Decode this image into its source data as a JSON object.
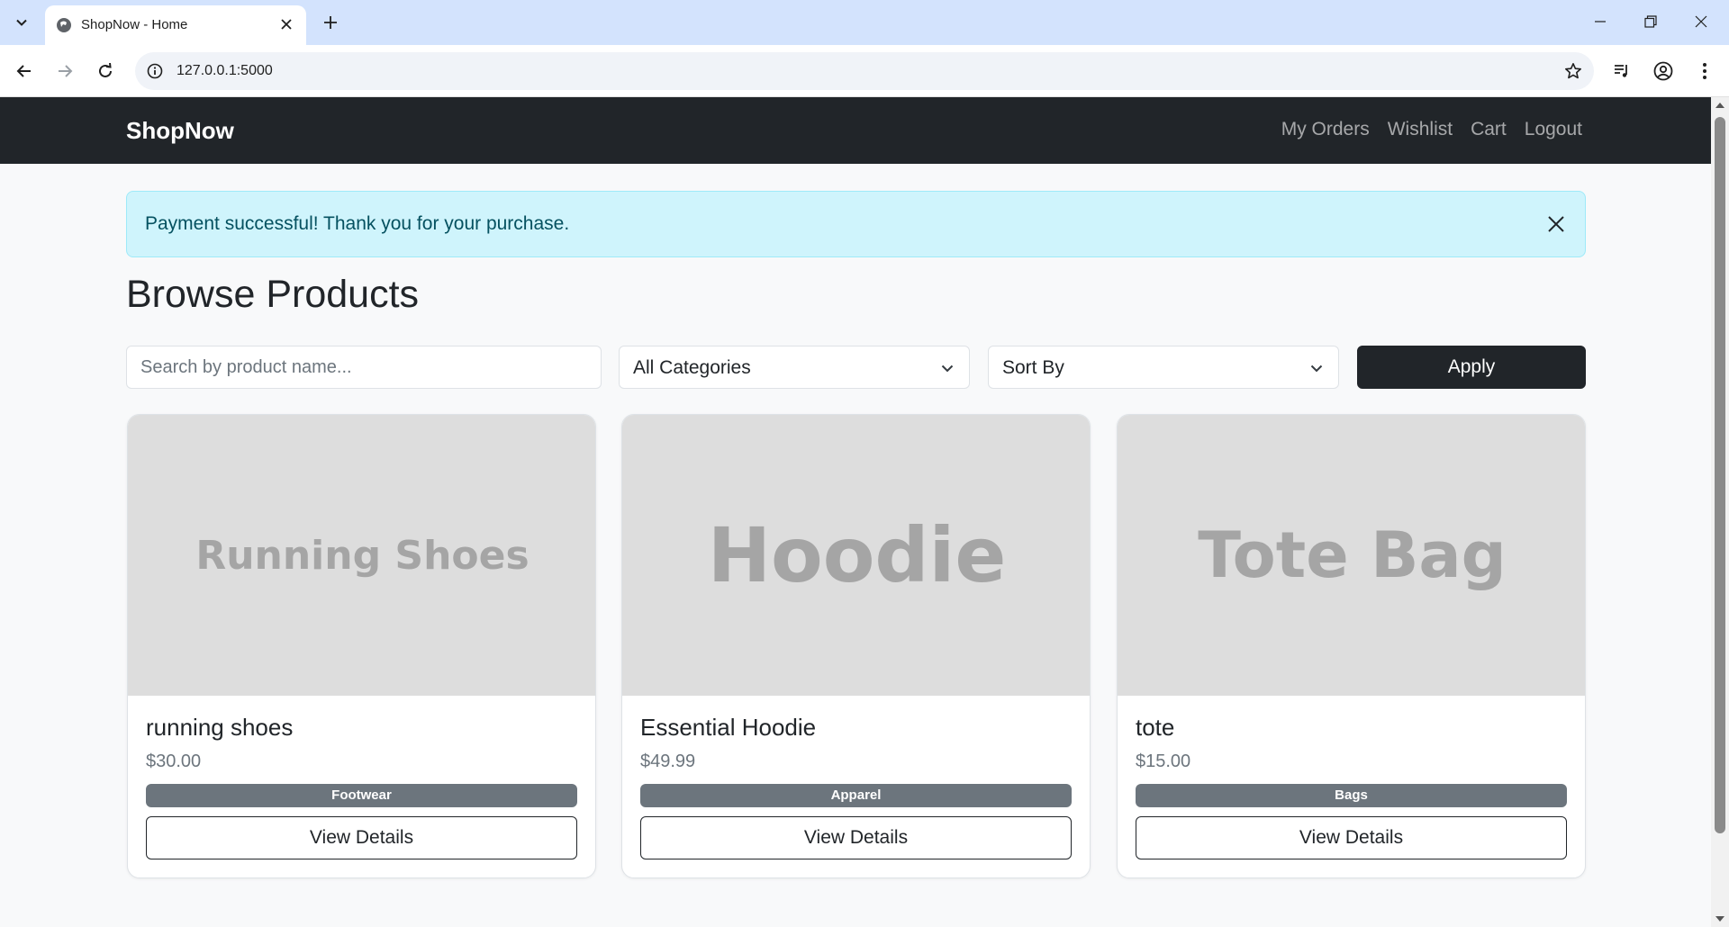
{
  "browser": {
    "tab_title": "ShopNow - Home",
    "url": "127.0.0.1:5000"
  },
  "navbar": {
    "brand": "ShopNow",
    "links": [
      "My Orders",
      "Wishlist",
      "Cart",
      "Logout"
    ]
  },
  "alert": {
    "message": "Payment successful! Thank you for your purchase."
  },
  "page": {
    "title": "Browse Products"
  },
  "filters": {
    "search_placeholder": "Search by product name...",
    "category_selected": "All Categories",
    "sort_selected": "Sort By",
    "apply_label": "Apply"
  },
  "products": [
    {
      "image_text": "Running Shoes",
      "name": "running shoes",
      "price": "$30.00",
      "category": "Footwear",
      "button": "View Details"
    },
    {
      "image_text": "Hoodie",
      "name": "Essential Hoodie",
      "price": "$49.99",
      "category": "Apparel",
      "button": "View Details"
    },
    {
      "image_text": "Tote Bag",
      "name": "tote",
      "price": "$15.00",
      "category": "Bags",
      "button": "View Details"
    }
  ]
}
